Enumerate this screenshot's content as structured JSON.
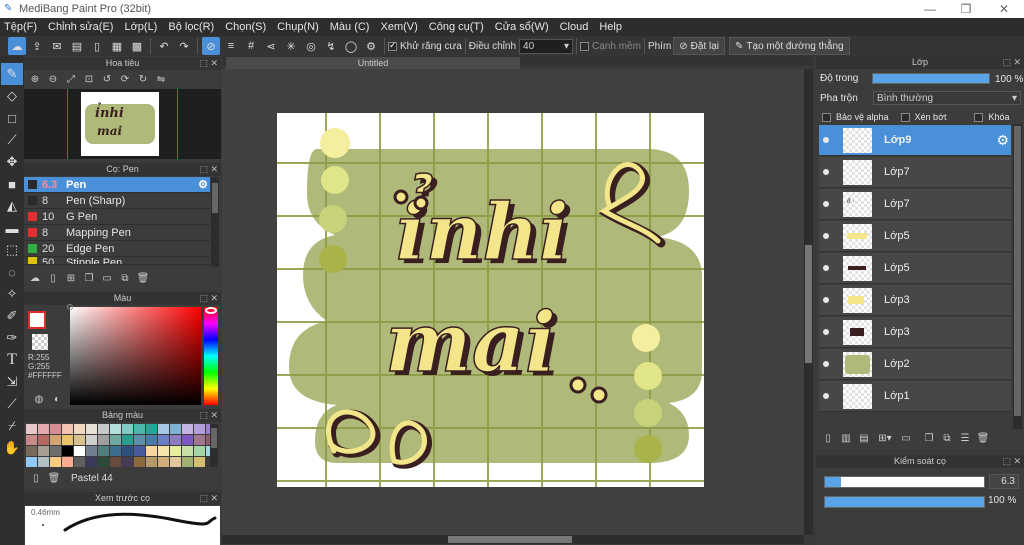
{
  "window": {
    "title": "MediBang Paint Pro (32bit)"
  },
  "menu": [
    "Tệp(F)",
    "Chỉnh sửa(E)",
    "Lớp(L)",
    "Bộ lọc(R)",
    "Chọn(S)",
    "Chụp(N)",
    "Màu (C)",
    "Xem(V)",
    "Công cụ(T)",
    "Cửa sổ(W)",
    "Cloud",
    "Help"
  ],
  "toolbar": {
    "antialias_label": "Khử răng cưa",
    "correction_label": "Điều chỉnh",
    "correction_value": "40",
    "soft_edge_label": "Cạnh mềm",
    "key_label": "Phím",
    "reset_label": "Đặt lại",
    "create_line_label": "Tạo một đường thẳng"
  },
  "navigator": {
    "title": "Hoa tiêu"
  },
  "brush_panel": {
    "title": "Cọ: Pen",
    "brushes": [
      {
        "size": "6.3",
        "name": "Pen",
        "color": "#2a2a2a"
      },
      {
        "size": "8",
        "name": "Pen (Sharp)",
        "color": "#2a2a2a"
      },
      {
        "size": "10",
        "name": "G Pen",
        "color": "#e03030"
      },
      {
        "size": "8",
        "name": "Mapping Pen",
        "color": "#e03030"
      },
      {
        "size": "20",
        "name": "Edge Pen",
        "color": "#30b040"
      },
      {
        "size": "50",
        "name": "Stipple Pen",
        "color": "#e0c020"
      }
    ]
  },
  "color_panel": {
    "title": "Màu",
    "r": "R:255",
    "g": "G:255",
    "hex": "#FFFFFF",
    "primary": "#ffffff"
  },
  "palette_panel": {
    "title": "Bảng màu",
    "name": "Pastel 44",
    "swatches": [
      "#e9c6c9",
      "#e4a9ad",
      "#d98d94",
      "#f2c2b2",
      "#f4d7c1",
      "#e8e0d5",
      "#c9c9c9",
      "#b2dfdb",
      "#80cbc4",
      "#4db6ac",
      "#26a69a",
      "#a7c7e7",
      "#7fb3d5",
      "#c5b3e6",
      "#b39ddb",
      "#9e7fc9",
      "#c98a8a",
      "#b5695f",
      "#d4a373",
      "#e9c46a",
      "#d9c28f",
      "#cfcfcf",
      "#9e9e9e",
      "#6fa8a0",
      "#2a9d8f",
      "#5c8fa8",
      "#4a7aa8",
      "#6b7fc9",
      "#8e7cc3",
      "#7e57c2",
      "#a0768d",
      "#8c5b6e",
      "#7a6a5b",
      "#a89f91",
      "#6d6d6d",
      "#000000",
      "#ffffff",
      "#708090",
      "#4e7f7a",
      "#3b6e8f",
      "#2f4f7f",
      "#4a5a9f",
      "#f7d6a0",
      "#f3e5ab",
      "#e6ee9c",
      "#c5e1a5",
      "#a5d6a7",
      "#9fd8e0",
      "#90caf9",
      "#b0bec5",
      "#ffcc80",
      "#ffab91",
      "#5e5e5e",
      "#3a3a5a",
      "#2e4a3a",
      "#6a4a3a",
      "#4a3a5a",
      "#8a6a3a",
      "#b89a6a",
      "#cfae7a",
      "#e0c89a",
      "#a0b070",
      "#d4c070"
    ]
  },
  "preview_panel": {
    "title": "Xem trước cọ",
    "size": "0.46mm"
  },
  "canvas": {
    "title": "Untitled",
    "text_line1": "ỉnhi",
    "text_line2": "mai"
  },
  "layers_panel": {
    "title": "Lớp",
    "opacity_label": "Độ trong",
    "opacity_value": "100 %",
    "opacity": 1.0,
    "blend_label": "Pha trộn",
    "blend_value": "Bình thường",
    "protect_alpha_label": "Bảo vệ alpha",
    "clipping_label": "Xén bớt",
    "lock_label": "Khóa",
    "layers": [
      "Lớp9",
      "Lớp7",
      "Lớp7",
      "Lớp5",
      "Lớp5",
      "Lớp3",
      "Lớp3",
      "Lớp2",
      "Lớp1"
    ]
  },
  "brush_control": {
    "title": "Kiểm soát cọ",
    "size_value": "6.3",
    "size_fraction": 0.1,
    "opacity_value": "100 %",
    "opacity_fraction": 1.0
  },
  "colors": {
    "accent": "#4a90d9",
    "canvas_bg": "#afb97a",
    "dot_light": "#f3ef9e",
    "lettering": "#f3e68a",
    "outline": "#3a1f20"
  }
}
